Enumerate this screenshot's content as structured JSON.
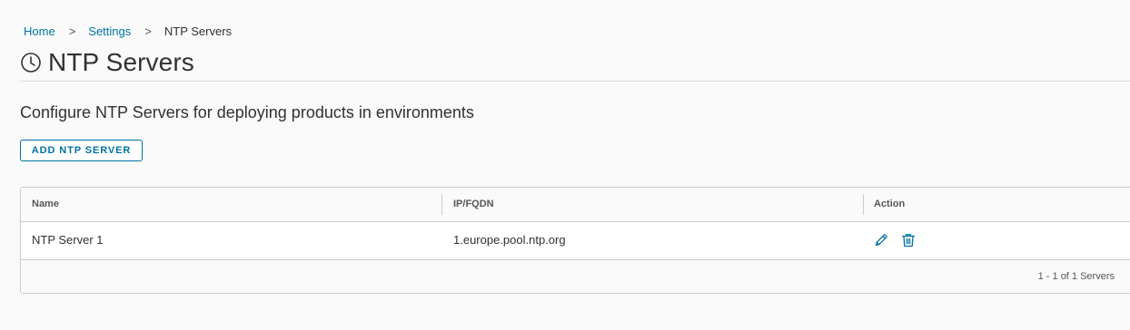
{
  "breadcrumb": {
    "home": "Home",
    "settings": "Settings",
    "current": "NTP Servers",
    "separator": ">"
  },
  "page": {
    "title": "NTP Servers",
    "title_icon": "clock-icon",
    "subtitle": "Configure NTP Servers for deploying products in environments"
  },
  "toolbar": {
    "add_label": "ADD NTP SERVER"
  },
  "grid": {
    "columns": [
      "Name",
      "IP/FQDN",
      "Action"
    ],
    "rows": [
      {
        "name": "NTP Server 1",
        "ip_fqdn": "1.europe.pool.ntp.org",
        "actions": [
          "edit-icon",
          "delete-icon"
        ]
      }
    ],
    "footer": "1 - 1 of 1 Servers"
  },
  "colors": {
    "accent": "#0072a3",
    "text": "#313131",
    "border": "#cccccc",
    "background": "#fafafa"
  }
}
